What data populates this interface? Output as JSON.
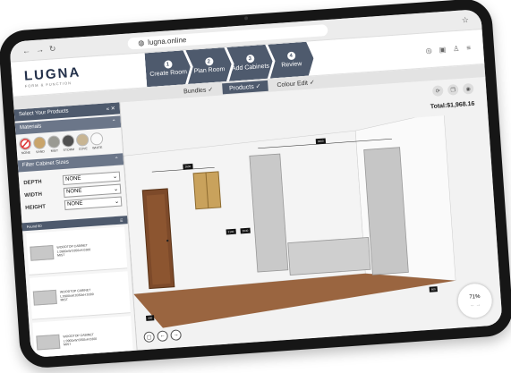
{
  "browser": {
    "url": "lugna.online"
  },
  "brand": {
    "name": "LUGNA",
    "tagline": "FORM & FUNCTION"
  },
  "steps": [
    {
      "num": "1",
      "label": "Create Room"
    },
    {
      "num": "2",
      "label": "Plan Room"
    },
    {
      "num": "3",
      "label": "Add Cabinets"
    },
    {
      "num": "4",
      "label": "Review"
    }
  ],
  "subtabs": [
    {
      "label": "Bundles ✓"
    },
    {
      "label": "Products ✓"
    },
    {
      "label": "Colour Edit ✓"
    }
  ],
  "sidebar": {
    "title": "Select Your Products",
    "materials_label": "Materials",
    "swatches": [
      {
        "label": "NONE",
        "color": "#ffffff"
      },
      {
        "label": "SAND",
        "color": "#c9a46a"
      },
      {
        "label": "MIST",
        "color": "#9a9a93"
      },
      {
        "label": "STORM",
        "color": "#505050"
      },
      {
        "label": "COVE",
        "color": "#c8b593"
      },
      {
        "label": "WHITE",
        "color": "#fafafa"
      }
    ],
    "filter_label": "Filter Cabinet Sizes",
    "filters": [
      {
        "label": "DEPTH",
        "value": "NONE"
      },
      {
        "label": "WIDTH",
        "value": "NONE"
      },
      {
        "label": "HEIGHT",
        "value": "NONE"
      }
    ],
    "found_label": "Found 60",
    "products": [
      {
        "name": "WOODTOP CABINET",
        "detail": "L:0900xW:0350xH:0300",
        "sku": "MIST"
      },
      {
        "name": "WOODTOP CABINET",
        "detail": "L:0900xW:0350xH:0300",
        "sku": "MIST"
      },
      {
        "name": "WOODTOP CABINET",
        "detail": "L:0900xW:0350xH:0300",
        "sku": "MIST"
      }
    ]
  },
  "canvas": {
    "total": "Total:$1,968.16",
    "zoom": "71%",
    "dimensions": {
      "window_width": "2600",
      "wall_width": "3200",
      "door_height": "2100",
      "window_height": "2040",
      "floor_a": "300",
      "floor_b": "600"
    }
  }
}
